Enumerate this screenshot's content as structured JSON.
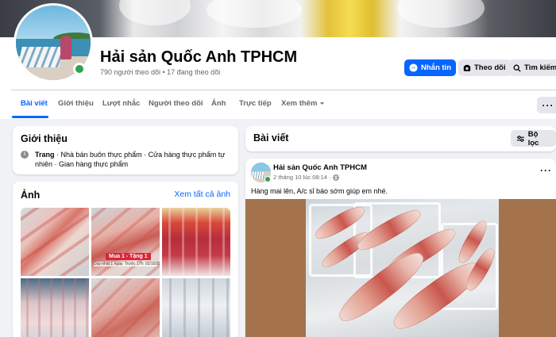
{
  "page": {
    "name": "Hải sản Quốc Anh TPHCM",
    "followers_text": "790 người theo dõi • 17 đang theo dõi"
  },
  "header_actions": {
    "message_label": "Nhắn tin",
    "follow_label": "Theo dõi",
    "search_label": "Tìm kiếm"
  },
  "tabs": [
    {
      "label": "Bài viết",
      "active": true
    },
    {
      "label": "Giới thiệu"
    },
    {
      "label": "Lượt nhắc"
    },
    {
      "label": "Người theo dõi"
    },
    {
      "label": "Ảnh"
    },
    {
      "label": "Trực tiếp"
    },
    {
      "label": "Xem thêm"
    }
  ],
  "intro": {
    "title": "Giới thiệu",
    "category_label": "Trang",
    "categories": " · Nhà bán buôn thực phẩm · Cửa hàng thực phẩm tự nhiên · Gian hàng thực phẩm"
  },
  "photos": {
    "title": "Ảnh",
    "see_all": "Xem tất cả ảnh",
    "promo_badge": "Mua 1 - Tặng 1",
    "promo_subtext": "Duy nhất 1 ngày. Trước 17h: 02/10/2025"
  },
  "posts": {
    "title": "Bài viết",
    "filter_label": "Bộ lọc",
    "items": [
      {
        "author": "Hải sản Quốc Anh TPHCM",
        "time": "2 tháng 10 lúc 08:14 ·",
        "text": "Hàng mai lên, A/c sỉ báo sớm giúp em nhé."
      }
    ]
  },
  "colors": {
    "accent": "#0866ff",
    "online": "#31a24c",
    "secondary_button": "#e4e6eb",
    "background": "#f0f2f5"
  },
  "icons": [
    "messenger-icon",
    "follow-icon",
    "search-icon",
    "more-dots-icon",
    "info-icon",
    "filter-icon",
    "globe-icon",
    "caret-down-icon"
  ]
}
